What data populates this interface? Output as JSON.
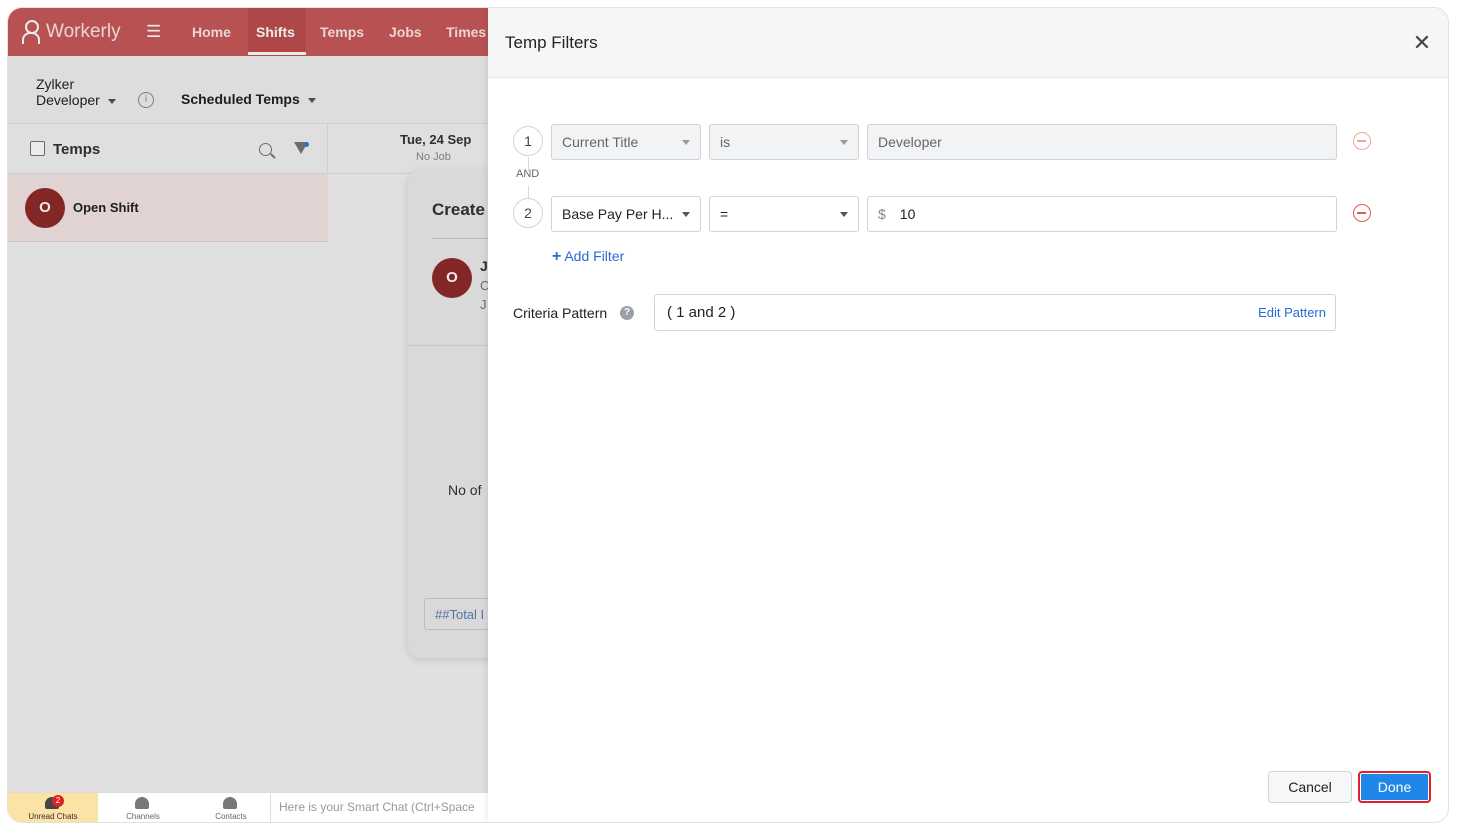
{
  "app": {
    "name": "Workerly",
    "nav": [
      "Home",
      "Shifts",
      "Temps",
      "Jobs",
      "Times"
    ],
    "active_nav": "Shifts",
    "org_line1": "Zylker",
    "org_line2": "Developer",
    "view": "Scheduled Temps"
  },
  "grid": {
    "temps_header": "Temps",
    "date_label": "Tue, 24 Sep",
    "date_sub": "No Job",
    "open_shift_initial": "O",
    "open_shift_label": "Open Shift"
  },
  "create_card": {
    "title": "Create",
    "avatar_initial": "O",
    "line1": "J",
    "line2": "C",
    "line3": "J",
    "no_of": "No of",
    "total_tag": "##Total I"
  },
  "bottom_bar": {
    "unread_label": "Unread Chats",
    "unread_count": "2",
    "channels_label": "Channels",
    "contacts_label": "Contacts",
    "smart_chat_placeholder": "Here is your Smart Chat (Ctrl+Space"
  },
  "modal": {
    "title": "Temp Filters",
    "close_glyph": "✕",
    "connector": "AND",
    "filters": [
      {
        "index": "1",
        "field": "Current Title",
        "operator": "is",
        "value": "Developer",
        "currency": ""
      },
      {
        "index": "2",
        "field": "Base Pay Per H...",
        "operator": "=",
        "value": "10",
        "currency": "$"
      }
    ],
    "add_filter_label": "Add Filter",
    "criteria_label": "Criteria Pattern",
    "criteria_pattern": "( 1 and 2 )",
    "edit_pattern_label": "Edit Pattern",
    "cancel_label": "Cancel",
    "done_label": "Done"
  },
  "colors": {
    "brand_header": "#c85a5a",
    "link": "#2b6ad1",
    "primary_button": "#1f87e8",
    "remove_icon": "#e15a4f"
  }
}
